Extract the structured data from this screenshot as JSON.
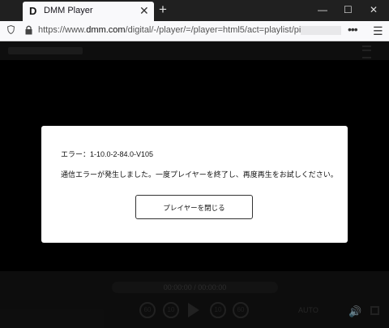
{
  "browser": {
    "tab_title": "DMM Player",
    "favicon": "D",
    "url_prefix": "https://www.",
    "url_host": "dmm.com",
    "url_path": "/digital/-/player/=/player=html5/act=playlist/pid=",
    "new_tab_label": "+",
    "close_tab_label": "✕",
    "more_label": "•••",
    "menu_label": "☰",
    "window_buttons": {
      "minimize": "—",
      "maximize": "☐",
      "close": "✕"
    }
  },
  "player": {
    "time_display": "00:00:00 / 00:00:00",
    "skip_back_60": "60",
    "skip_back_10": "10",
    "skip_fwd_10": "10",
    "skip_fwd_60": "60",
    "quality": "AUTO"
  },
  "dialog": {
    "error_code": "エラー：1-10.0-2-84.0-V105",
    "message": "通信エラーが発生しました。一度プレイヤーを終了し、再度再生をお試しください。",
    "close_button": "プレイヤーを閉じる"
  },
  "colors": {
    "chrome_dark": "#202020",
    "chrome_light": "#f9f9fb",
    "player_bg": "#000000",
    "dialog_bg": "#ffffff"
  }
}
